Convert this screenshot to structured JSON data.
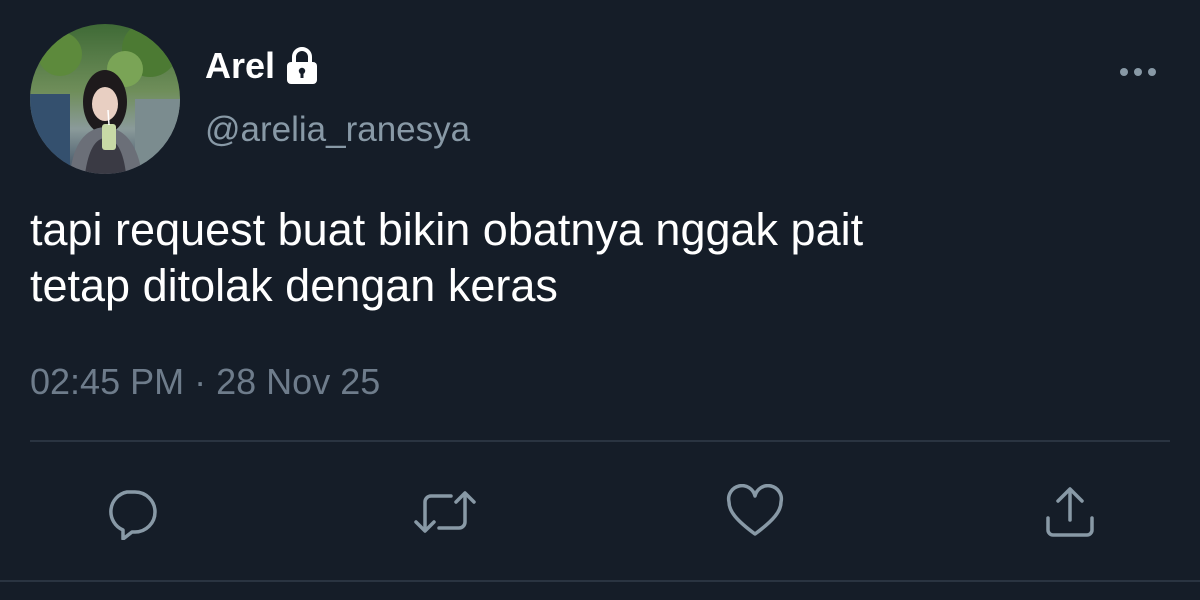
{
  "user": {
    "display_name": "Arel",
    "handle": "@arelia_ranesya",
    "protected_icon": "lock-icon",
    "avatar_icon": "profile-photo"
  },
  "tweet": {
    "text_lines": [
      "tapi request buat bikin obatnya nggak pait",
      "tetap ditolak dengan keras"
    ],
    "time": "02:45 PM",
    "separator": "·",
    "date": "28 Nov 25"
  },
  "actions": [
    {
      "icon": "reply-icon"
    },
    {
      "icon": "retweet-icon"
    },
    {
      "icon": "like-icon"
    },
    {
      "icon": "share-icon"
    }
  ],
  "menu_icon": "more-options-icon",
  "colors": {
    "background": "#151d28",
    "primary_text": "#ffffff",
    "secondary_text": "#8899a6",
    "icon": "#8899a6",
    "divider": "#2a3441"
  }
}
